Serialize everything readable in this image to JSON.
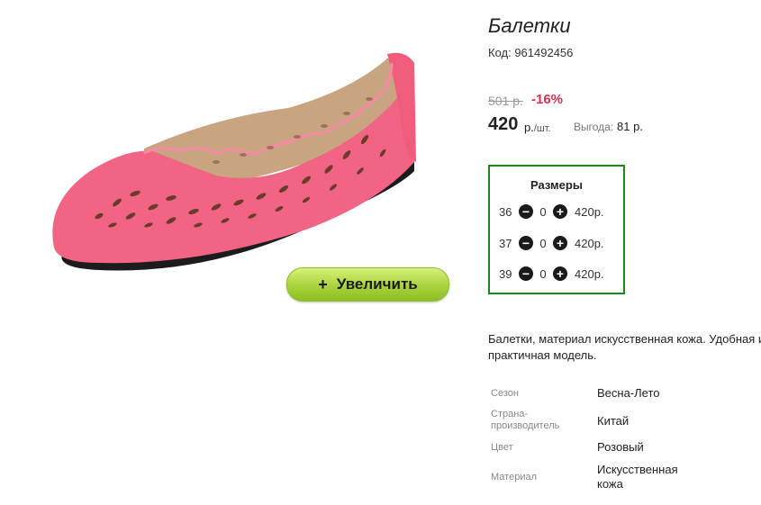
{
  "product": {
    "title": "Балетки",
    "code": "Код: 961492456",
    "old_price": "501 р.",
    "discount": "-16%",
    "price": "420",
    "price_unit": "р.",
    "price_per": "/шт.",
    "benefit_label": "Выгода:",
    "benefit_value": "81 р.",
    "zoom_button": "Увеличить",
    "zoom_icon": "+",
    "image_color": "#f26483"
  },
  "sizes": {
    "title": "Размеры",
    "rows": [
      {
        "size": "36",
        "qty": "0",
        "price": "420р."
      },
      {
        "size": "37",
        "qty": "0",
        "price": "420р."
      },
      {
        "size": "39",
        "qty": "0",
        "price": "420р."
      }
    ],
    "minus_icon": "−",
    "plus_icon": "+"
  },
  "description": {
    "line1": "Балетки, материал искусственная кожа. Удобная и",
    "line2": "практичная модель."
  },
  "properties": [
    {
      "label": "Сезон",
      "value": "Весна-Лето"
    },
    {
      "label": "Страна-\nпроизводитель",
      "value": "Китай"
    },
    {
      "label": "Цвет",
      "value": "Розовый"
    },
    {
      "label": "Материал",
      "value": "Искусственная\nкожа"
    }
  ],
  "colors": {
    "accent_green": "#1a8a1a",
    "discount_red": "#e0314c",
    "button_green": "#a8d23c"
  }
}
